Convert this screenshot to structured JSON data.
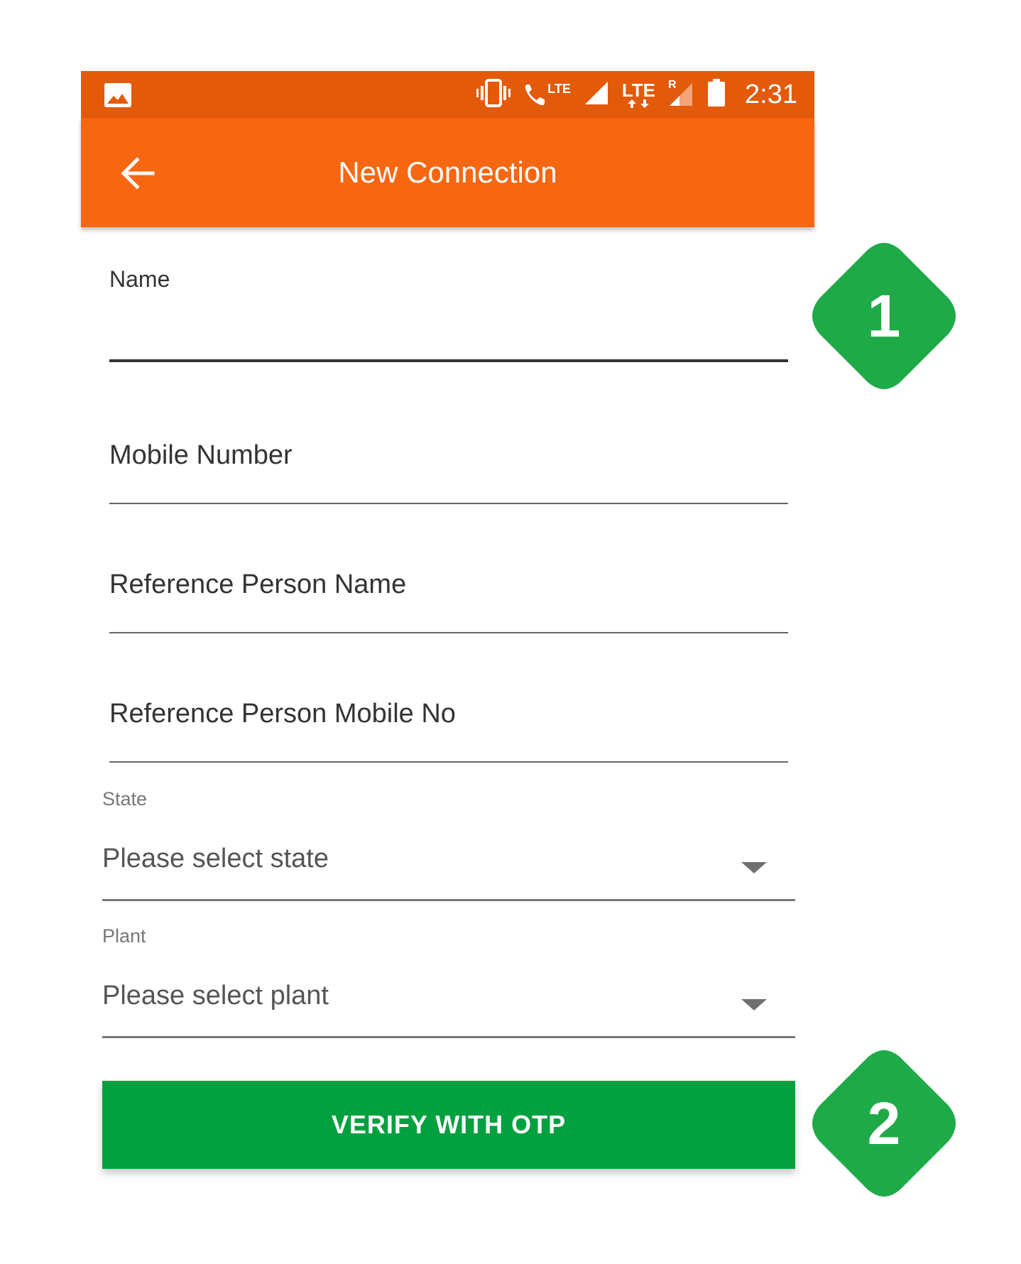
{
  "status_bar": {
    "lte_small": "LTE",
    "lte_large": "LTE",
    "roaming": "R",
    "time": "2:31"
  },
  "app_bar": {
    "title": "New Connection"
  },
  "form": {
    "name_label": "Name",
    "name_value": "",
    "mobile_hint": "Mobile Number",
    "ref_name_hint": "Reference Person Name",
    "ref_mobile_hint": "Reference Person Mobile No",
    "state_label": "State",
    "state_value": "Please select state",
    "plant_label": "Plant",
    "plant_value": "Please select plant",
    "verify_button": "VERIFY WITH OTP"
  },
  "callouts": [
    {
      "number": "1"
    },
    {
      "number": "2"
    }
  ],
  "colors": {
    "status_bar": "#E25A0A",
    "app_bar": "#F76711",
    "button": "#02A03E",
    "callout": "#1FAA48"
  },
  "icons": {
    "status": [
      "image-icon",
      "vibrate-icon",
      "lte-call-icon",
      "signal-icon",
      "lte-data-icon",
      "roaming-signal-icon",
      "battery-icon"
    ],
    "nav": "back-arrow-icon",
    "dropdown": "dropdown-arrow-icon"
  }
}
